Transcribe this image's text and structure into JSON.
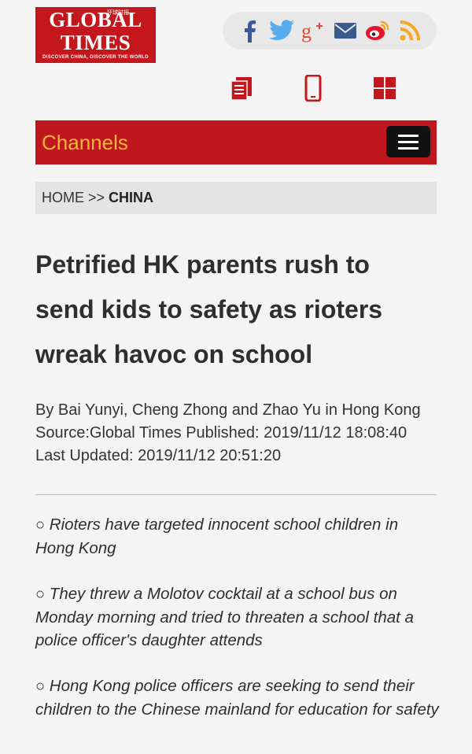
{
  "logo": {
    "line1": "GLOBAL",
    "line2": "TIMES",
    "chinese": "环球时报",
    "tagline": "DISCOVER CHINA, DISCOVER THE WORLD",
    "color": "#c4171d"
  },
  "social": [
    {
      "name": "facebook-icon",
      "color": "#3b5998"
    },
    {
      "name": "twitter-icon",
      "color": "#55acee"
    },
    {
      "name": "google-plus-icon",
      "color": "#dd4b39"
    },
    {
      "name": "mail-icon",
      "color": "#3a5a8c"
    },
    {
      "name": "weibo-icon",
      "color": "#e6162d"
    },
    {
      "name": "rss-icon",
      "color": "#f5a623"
    }
  ],
  "tools": [
    {
      "name": "newspaper-icon"
    },
    {
      "name": "mobile-icon"
    },
    {
      "name": "grid-icon"
    }
  ],
  "channels": {
    "label": "Channels",
    "bar_color": "#c0171e",
    "label_color": "#f2b63c"
  },
  "breadcrumb": {
    "home": "HOME",
    "separator": ">>",
    "current": "CHINA"
  },
  "article": {
    "title": "Petrified HK parents rush to send kids to safety as rioters wreak havoc on school",
    "byline": "By Bai Yunyi, Cheng Zhong and Zhao Yu in Hong Kong Source:Global Times Published: 2019/11/12 18:08:40 Last Updated: 2019/11/12 20:51:20",
    "bullet_symbol": "○",
    "points": [
      "Rioters have targeted innocent school children in Hong Kong",
      "They threw a Molotov cocktail at a school bus on Monday morning and tried to threaten a school that a police officer's daughter attends",
      "Hong Kong police officers are seeking to send their children to the Chinese mainland for education for safety"
    ]
  }
}
